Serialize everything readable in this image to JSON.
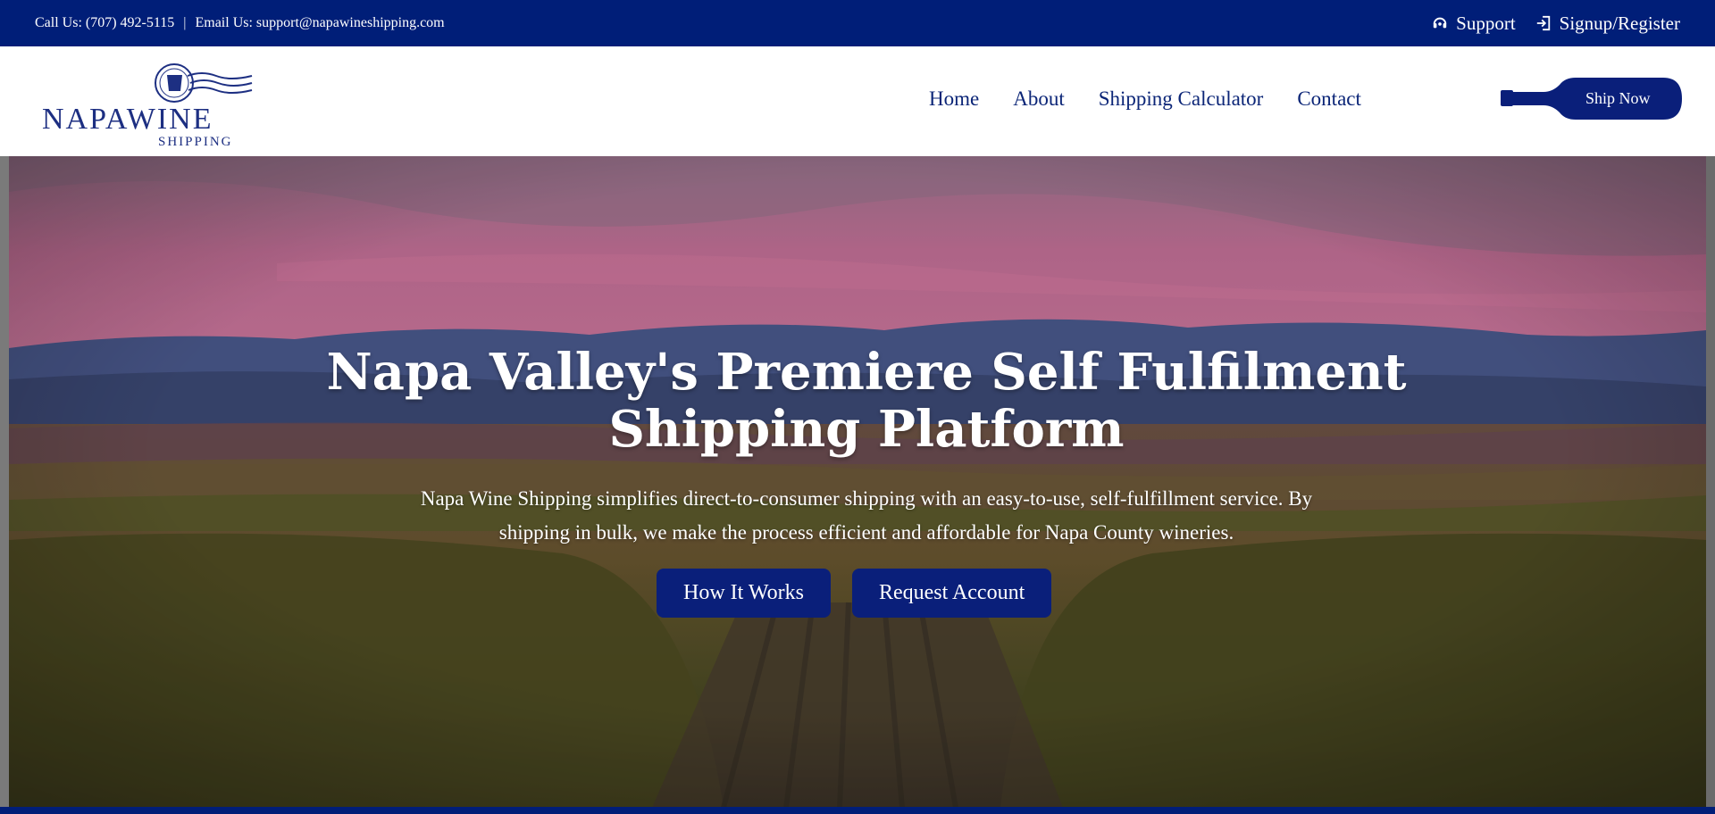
{
  "topbar": {
    "phone": "Call Us: (707) 492-5115",
    "separator": "|",
    "email": "Email Us: support@napawineshipping.com",
    "support_label": "Support",
    "support_icon": "headset-icon",
    "signup_label": "Signup/Register",
    "signup_icon": "login-icon"
  },
  "header": {
    "logo_main": "NAPAWINE",
    "logo_sub": "SHIPPING",
    "nav": [
      "Home",
      "About",
      "Shipping Calculator",
      "Contact"
    ],
    "ship_button": "Ship Now"
  },
  "hero": {
    "title": "Napa Valley's Premiere Self Fulfilment Shipping Platform",
    "subtitle": "Napa Wine Shipping simplifies direct-to-consumer shipping with an easy-to-use, self-fulfillment service. By shipping in bulk, we make the process efficient and affordable for Napa County wineries.",
    "buttons": [
      "How It Works",
      "Request Account"
    ]
  },
  "colors": {
    "brand_navy": "#001e78",
    "button_navy": "#0a1f7a",
    "white": "#ffffff"
  }
}
